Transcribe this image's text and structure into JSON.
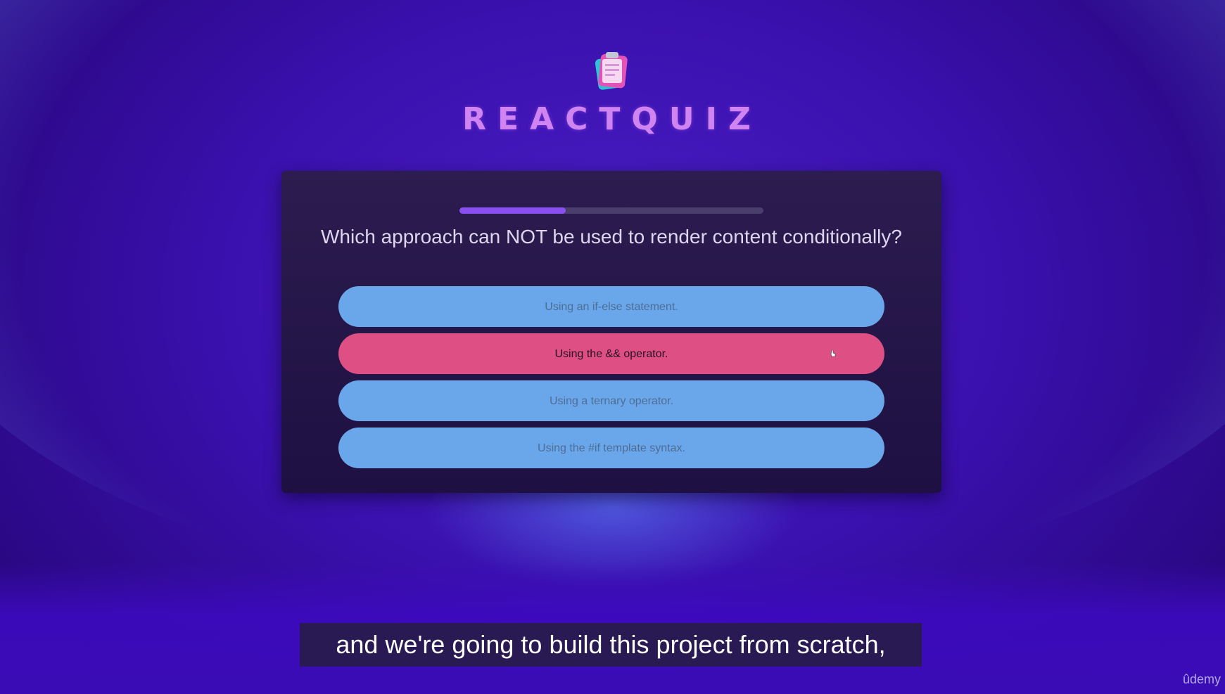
{
  "brand": {
    "title": "REACTQUIZ",
    "logo_icon": "clipboard-icon"
  },
  "quiz": {
    "progress_fraction": 0.35,
    "question": "Which approach can NOT be used to render content conditionally?",
    "options": [
      {
        "label": "Using an if-else statement.",
        "selected": false
      },
      {
        "label": "Using the && operator.",
        "selected": true
      },
      {
        "label": "Using a ternary operator.",
        "selected": false
      },
      {
        "label": "Using the #if template syntax.",
        "selected": false
      }
    ]
  },
  "colors": {
    "brand_purple": "#d084f2",
    "progress_fill": "#8a4ff0",
    "option_default": "#6aa7ea",
    "option_selected": "#de4f84"
  },
  "caption": {
    "text": "and we're going to build this project from scratch,"
  },
  "watermark": {
    "text": "ûdemy"
  }
}
